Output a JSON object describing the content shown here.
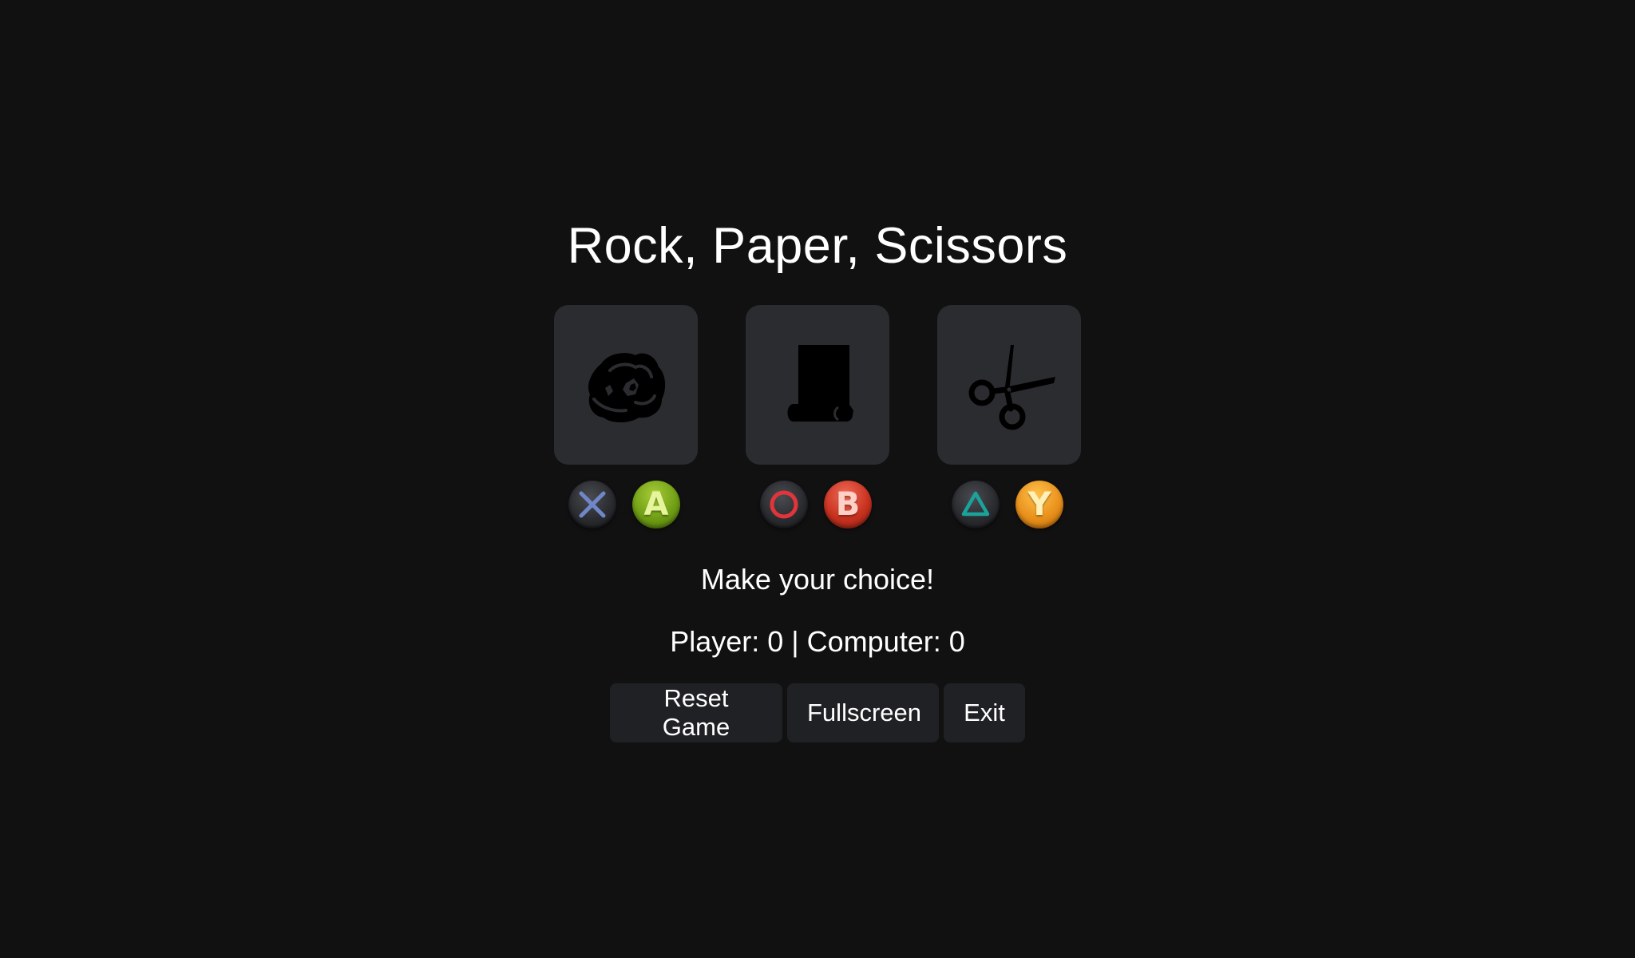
{
  "title": "Rock, Paper, Scissors",
  "choices": [
    {
      "id": "rock",
      "icon": "rock-icon",
      "playstation_button": "cross",
      "xbox_button": "A"
    },
    {
      "id": "paper",
      "icon": "paper-scroll-icon",
      "playstation_button": "circle",
      "xbox_button": "B"
    },
    {
      "id": "scissors",
      "icon": "scissors-icon",
      "playstation_button": "triangle",
      "xbox_button": "Y"
    }
  ],
  "status_message": "Make your choice!",
  "score_text": "Player: 0 | Computer: 0",
  "buttons": {
    "reset": "Reset Game",
    "fullscreen": "Fullscreen",
    "exit": "Exit"
  },
  "colors": {
    "background": "#111111",
    "card": "#2b2c2f",
    "button": "#202124",
    "cross": "#6f86c9",
    "circle": "#e0353b",
    "triangle": "#1aa39a",
    "xbox_a": "#6f9e15",
    "xbox_b": "#c8321f",
    "xbox_y": "#e8901b"
  }
}
